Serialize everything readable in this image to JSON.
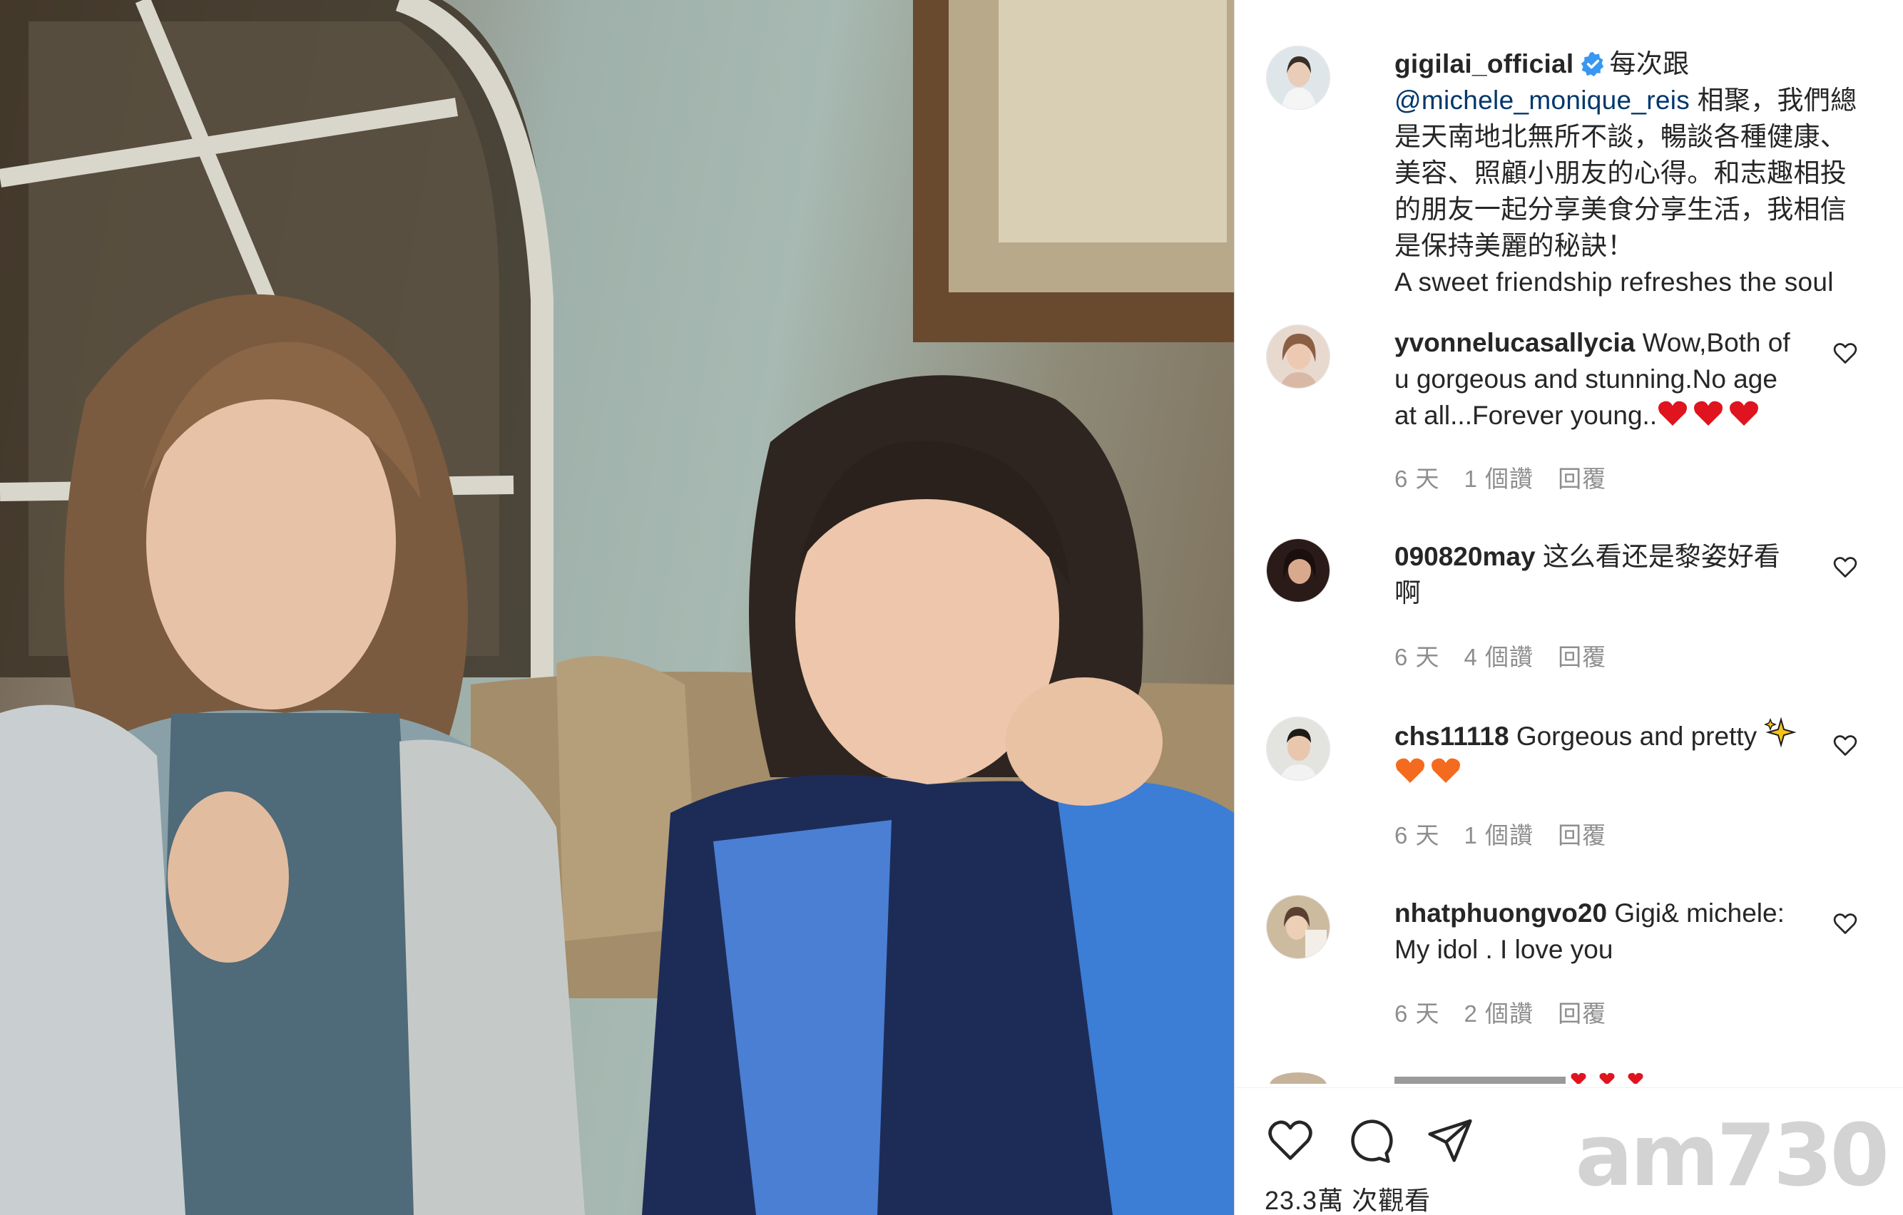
{
  "post": {
    "username": "gigilai_official",
    "caption_lines": [
      "每次跟",
      "@michele_monique_reis",
      " 相聚，我們總",
      "是天南地北無所不談，暢談各種健康、",
      "美容、照顧小朋友的心得。和志趣相投",
      "的朋友一起分享美食分享生活，我相信",
      "是保持美麗的秘訣！",
      "A sweet friendship refreshes the soul"
    ],
    "views_count": "23.3萬",
    "views_label": "次觀看"
  },
  "comments": [
    {
      "username": "yvonnelucasallycia",
      "lines": [
        "Wow,Both of",
        "u gorgeous and stunning.No age",
        "at all...Forever young.."
      ],
      "emoji": "red-hearts-x3",
      "time": "6 天",
      "likes": "1 個讚",
      "reply": "回覆"
    },
    {
      "username": "090820may",
      "lines": [
        "这么看还是黎姿好看",
        "啊"
      ],
      "time": "6 天",
      "likes": "4 個讚",
      "reply": "回覆"
    },
    {
      "username": "chs11118",
      "lines": [
        "Gorgeous and pretty"
      ],
      "emoji": "sparkles + orange-hearts-x2",
      "time": "6 天",
      "likes": "1 個讚",
      "reply": "回覆"
    },
    {
      "username": "nhatphuongvo20",
      "lines": [
        "Gigi& michele:",
        "My idol . I love you"
      ],
      "time": "6 天",
      "likes": "2 個讚",
      "reply": "回覆"
    }
  ],
  "watermark": "am730",
  "colors": {
    "text": "#262626",
    "muted": "#8e8e8e",
    "mention": "#00376b",
    "verified": "#3897f0",
    "heart_red": "#e0141e",
    "heart_orange": "#f46b1f"
  },
  "icons": [
    "verified-icon",
    "like-heart-icon",
    "comment-icon",
    "share-icon",
    "comment-like-icon"
  ]
}
